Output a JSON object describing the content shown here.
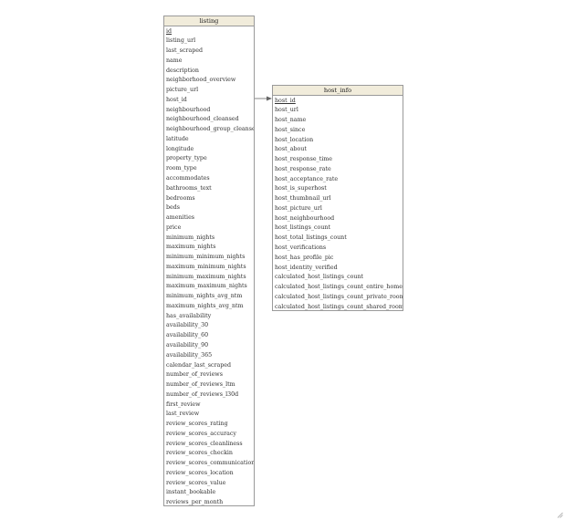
{
  "diagram": {
    "entities": [
      {
        "name": "listing",
        "primary_key": "id",
        "columns": [
          "id",
          "listing_url",
          "last_scraped",
          "name",
          "description",
          "neighborhood_overview",
          "picture_url",
          "host_id",
          "neighbourhood",
          "neighbourhood_cleansed",
          "neighbourhood_group_cleansed",
          "latitude",
          "longitude",
          "property_type",
          "room_type",
          "accommodates",
          "bathrooms_text",
          "bedrooms",
          "beds",
          "amenities",
          "price",
          "minimum_nights",
          "maximum_nights",
          "minimum_minimum_nights",
          "maximum_minimum_nights",
          "minimum_maximum_nights",
          "maximum_maximum_nights",
          "minimum_nights_avg_ntm",
          "maximum_nights_avg_ntm",
          "has_availability",
          "availability_30",
          "availability_60",
          "availability_90",
          "availability_365",
          "calendar_last_scraped",
          "number_of_reviews",
          "number_of_reviews_ltm",
          "number_of_reviews_l30d",
          "first_review",
          "last_review",
          "review_scores_rating",
          "review_scores_accuracy",
          "review_scores_cleanliness",
          "review_scores_checkin",
          "review_scores_communication",
          "review_scores_location",
          "review_scores_value",
          "instant_bookable",
          "reviews_per_month"
        ]
      },
      {
        "name": "host_info",
        "primary_key": "host_id",
        "columns": [
          "host_id",
          "host_url",
          "host_name",
          "host_since",
          "host_location",
          "host_about",
          "host_response_time",
          "host_response_rate",
          "host_acceptance_rate",
          "host_is_superhost",
          "host_thumbnail_url",
          "host_picture_url",
          "host_neighbourhood",
          "host_listings_count",
          "host_total_listings_count",
          "host_verifications",
          "host_has_profile_pic",
          "host_identity_verified",
          "calculated_host_listings_count",
          "calculated_host_listings_count_entire_homes",
          "calculated_host_listings_count_private_rooms",
          "calculated_host_listings_count_shared_rooms"
        ]
      }
    ],
    "relations": [
      {
        "from_entity": "listing",
        "from_column": "host_id",
        "to_entity": "host_info",
        "to_column": "host_id"
      }
    ]
  },
  "colors": {
    "header_bg": "#f1ecdb",
    "border": "#9a9a9a",
    "text": "#333333",
    "connector": "#666666"
  }
}
